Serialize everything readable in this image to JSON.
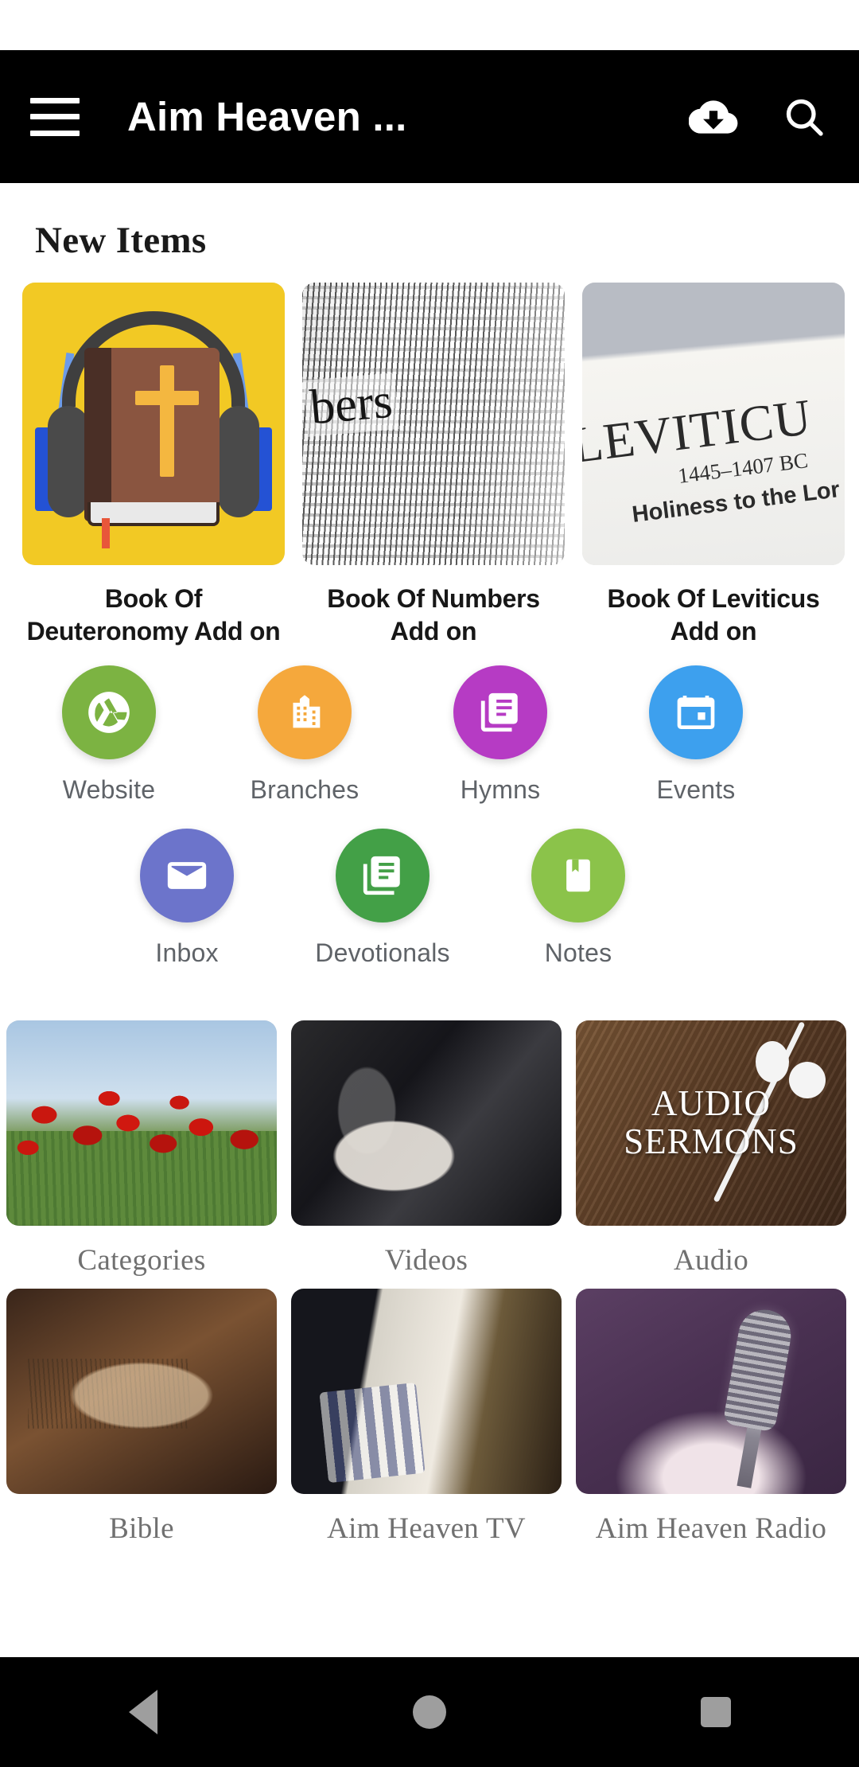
{
  "appbar": {
    "title": "Aim Heaven ...",
    "menu_icon": "hamburger-menu-icon",
    "download_icon": "cloud-download-icon",
    "search_icon": "search-icon"
  },
  "sections": {
    "new_items_title": "New Items"
  },
  "new_items": [
    {
      "title": "Book Of Deuteronomy Add on",
      "thumb": "audio-bible-app-icon"
    },
    {
      "title": "Book Of Numbers Add on",
      "thumb": "bible-page-numbers-photo"
    },
    {
      "title": "Book Of Leviticus Add on",
      "thumb": "bible-page-leviticus-photo"
    }
  ],
  "leviticus_art": {
    "heading": "LEVITICU",
    "date": "1445–1407 BC",
    "subtitle": "Holiness to the Lor"
  },
  "numbers_art": {
    "word": "bers"
  },
  "quick_links_row1": [
    {
      "label": "Website",
      "icon": "aperture-icon",
      "color": "#7CB342"
    },
    {
      "label": "Branches",
      "icon": "building-icon",
      "color": "#F5A83C"
    },
    {
      "label": "Hymns",
      "icon": "library-books-icon",
      "color": "#B63BC4"
    },
    {
      "label": "Events",
      "icon": "calendar-icon",
      "color": "#3DA0EE"
    }
  ],
  "quick_links_row2": [
    {
      "label": "Inbox",
      "icon": "envelope-icon",
      "color": "#6C74CB"
    },
    {
      "label": "Devotionals",
      "icon": "library-books-icon",
      "color": "#43A047"
    },
    {
      "label": "Notes",
      "icon": "bookmark-book-icon",
      "color": "#8BC34A"
    }
  ],
  "media_tiles_row1": [
    {
      "label": "Categories",
      "thumb": "poppy-field-photo"
    },
    {
      "label": "Videos",
      "thumb": "preacher-pulpit-photo"
    },
    {
      "label": "Audio",
      "thumb": "audio-sermons-earbuds-photo"
    }
  ],
  "media_tiles_row2": [
    {
      "label": "Bible",
      "thumb": "open-bible-glasses-photo"
    },
    {
      "label": "Aim Heaven TV",
      "thumb": "child-tablet-photo"
    },
    {
      "label": "Aim Heaven Radio",
      "thumb": "vintage-microphone-photo"
    }
  ],
  "audio_tile_art": {
    "line1": "AUDIO",
    "line2": "SERMONS"
  },
  "navbar": {
    "back": "back-triangle-icon",
    "home": "home-circle-icon",
    "recents": "recents-square-icon"
  }
}
